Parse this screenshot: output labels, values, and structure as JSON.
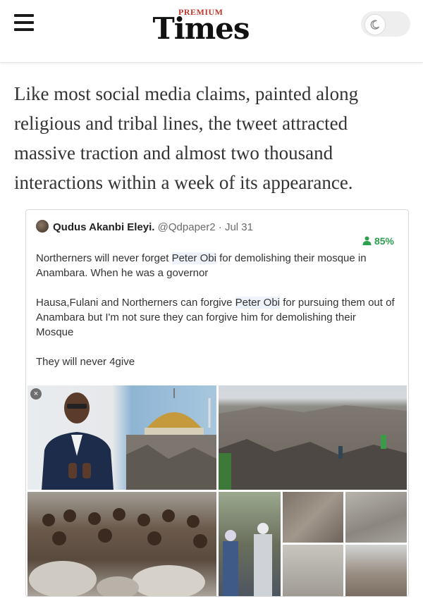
{
  "header": {
    "logo_premium": "PREMIUM",
    "logo_name": "Times",
    "menu_icon": "hamburger-menu-icon",
    "theme_icon": "moon-icon"
  },
  "article": {
    "paragraph": "Like most social media claims, painted along religious and tribal lines, the tweet attracted massive traction and almost two thousand interactions within a week of its appearance."
  },
  "tweet": {
    "author_name": "Qudus Akanbi Eleyi.",
    "handle": "@Qdpaper2",
    "separator": "·",
    "date": "Jul 31",
    "score": "85%",
    "p1_a": "Northerners will never forget ",
    "p1_hl": "Peter Obi",
    "p1_b": " for demolishing their mosque in Anambara. When he was a governor",
    "p2_a": "Hausa,Fulani and Northerners can forgive ",
    "p2_hl": "Peter Obi",
    "p2_b": " for pursuing them out of Anambara but I'm not sure they can forgive him for demolishing their Mosque",
    "p3": "They will never 4give",
    "close_glyph": "×"
  },
  "colors": {
    "score_green": "#2e9e4f",
    "logo_red": "#c0392b",
    "highlight": "#eef2fb"
  }
}
